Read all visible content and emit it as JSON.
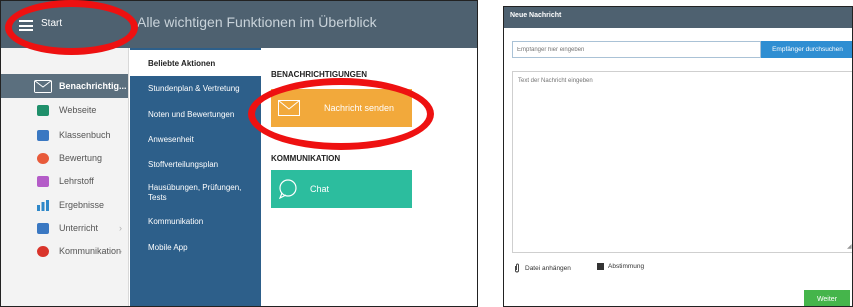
{
  "left": {
    "topbar": {
      "start_label": "Start",
      "subtitle": "Alle wichtigen Funktionen im Überblick"
    },
    "sidebar": {
      "items": [
        {
          "label": "Benachrichtig...",
          "icon": "envelope-icon",
          "active": true
        },
        {
          "label": "Webseite",
          "icon": "house-icon",
          "color": "#1f8f6a"
        },
        {
          "label": "Klassenbuch",
          "icon": "book-icon",
          "color": "#3a78c2"
        },
        {
          "label": "Bewertung",
          "icon": "grade-icon",
          "color": "#e85a3a"
        },
        {
          "label": "Lehrstoff",
          "icon": "folder-icon",
          "color": "#b45cc8"
        },
        {
          "label": "Ergebnisse",
          "icon": "bar-chart-icon",
          "color": "#2f88c9"
        },
        {
          "label": "Unterricht",
          "icon": "class-icon",
          "color": "#3a78c2",
          "chevron": "›"
        },
        {
          "label": "Kommunikation",
          "icon": "chat-bubbles-icon",
          "color": "#d9342b",
          "chevron": "›"
        }
      ]
    },
    "submenu": {
      "items": [
        {
          "label": "Beliebte Aktionen",
          "active": true
        },
        {
          "label": "Stundenplan & Vertretung"
        },
        {
          "label": "Noten und Bewertungen"
        },
        {
          "label": "Anwesenheit"
        },
        {
          "label": "Stoffverteilungsplan"
        },
        {
          "label": "Hausübungen, Prüfungen, Tests"
        },
        {
          "label": "Kommunikation"
        },
        {
          "label": "Mobile App"
        }
      ]
    },
    "content": {
      "section1": "BENACHRICHTIGUNGEN",
      "tile1": "Nachricht senden",
      "section2": "KOMMUNIKATION",
      "tile2": "Chat"
    }
  },
  "right": {
    "header": "Neue Nachricht",
    "recipient_placeholder": "Empfänger hier eingeben",
    "browse_label": "Empfänger durchsuchen",
    "message_placeholder": "Text der Nachricht eingeben",
    "attach_label": "Datei anhängen",
    "poll_label": "Abstimmung",
    "next_label": "Weiter"
  },
  "colors": {
    "topbar": "#4e6170",
    "submenu": "#2d5f8a",
    "orange_tile": "#f2a93b",
    "teal_tile": "#2cbd9e",
    "browse_button": "#2f8ed2",
    "next_button": "#45b54b",
    "highlight_ring": "#ee1111"
  }
}
